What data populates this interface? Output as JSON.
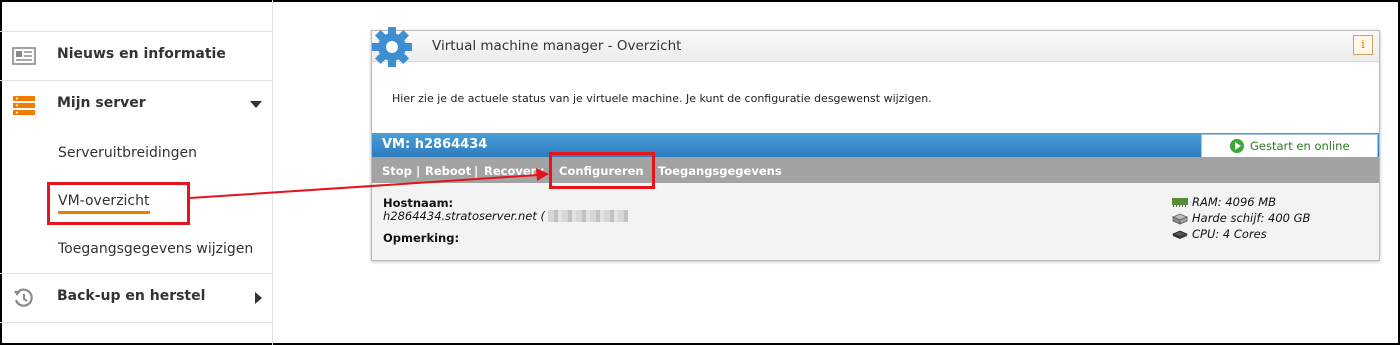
{
  "sidebar": {
    "items": [
      {
        "label": "Nieuws en informatie",
        "icon": "newspaper-icon"
      },
      {
        "label": "Mijn server",
        "icon": "server-icon"
      },
      {
        "label": "Back-up en herstel",
        "icon": "history-icon"
      }
    ],
    "subitems": [
      {
        "label": "Serveruitbreidingen"
      },
      {
        "label": "VM-overzicht"
      },
      {
        "label": "Toegangsgegevens wijzigen"
      }
    ]
  },
  "panel": {
    "title": "Virtual machine manager - Overzicht",
    "info": "i",
    "description": "Hier zie je de actuele status van je virtuele machine. Je kunt de configuratie desgewenst wijzigen.",
    "vm_name": "VM: h2864434",
    "status": "Gestart en online",
    "actions": {
      "stop": "Stop",
      "sep": "|",
      "reboot": "Reboot",
      "recovery": "Recovery",
      "configure": "Configureren",
      "access": "Toegangsgegevens"
    },
    "details": {
      "hostname_label": "Hostnaam:",
      "hostname_value": "h2864434.stratoserver.net (",
      "remark_label": "Opmerking:",
      "ram": "RAM: 4096 MB",
      "disk": "Harde schijf: 400 GB",
      "cpu": "CPU: 4 Cores"
    }
  },
  "colors": {
    "accent_orange": "#f07d00",
    "highlight_red": "#e5141b",
    "vm_bar_blue": "#2c7cbf",
    "status_green": "#3aa935"
  }
}
